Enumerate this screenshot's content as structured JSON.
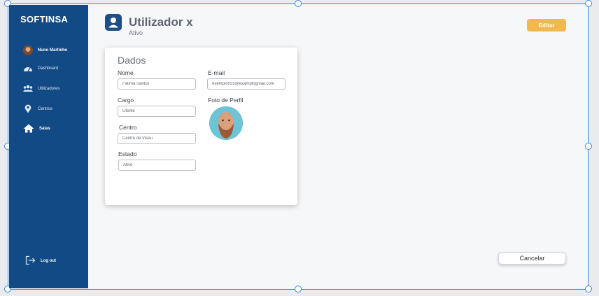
{
  "sidebar": {
    "logo": "SOFTINSA",
    "user": "Nuno Martinho",
    "items": [
      {
        "label": "Dashboard",
        "icon": "dashboard-icon"
      },
      {
        "label": "Utilizadores",
        "icon": "users-icon"
      },
      {
        "label": "Centros",
        "icon": "map-pin-icon"
      },
      {
        "label": "Salas",
        "icon": "home-icon",
        "active": true
      }
    ],
    "logout": "Log out"
  },
  "header": {
    "title": "Utilizador x",
    "status": "Ativo",
    "edit_label": "Editar"
  },
  "card": {
    "title": "Dados",
    "fields": {
      "nome": {
        "label": "Nome",
        "value": "Fatima Santos"
      },
      "email": {
        "label": "E-mail",
        "value": "exemplo555@examplogmail.com"
      },
      "cargo": {
        "label": "Cargo",
        "value": "Utente"
      },
      "foto": {
        "label": "Foto de Perfil"
      },
      "centro": {
        "label": "Centro",
        "value": "Centro de Viseu"
      },
      "estado": {
        "label": "Estado",
        "value": "Ativo"
      }
    }
  },
  "footer": {
    "cancel_label": "Cancelar"
  },
  "colors": {
    "sidebar": "#124a85",
    "accent": "#f2b74e",
    "selection": "#3b86d6"
  }
}
